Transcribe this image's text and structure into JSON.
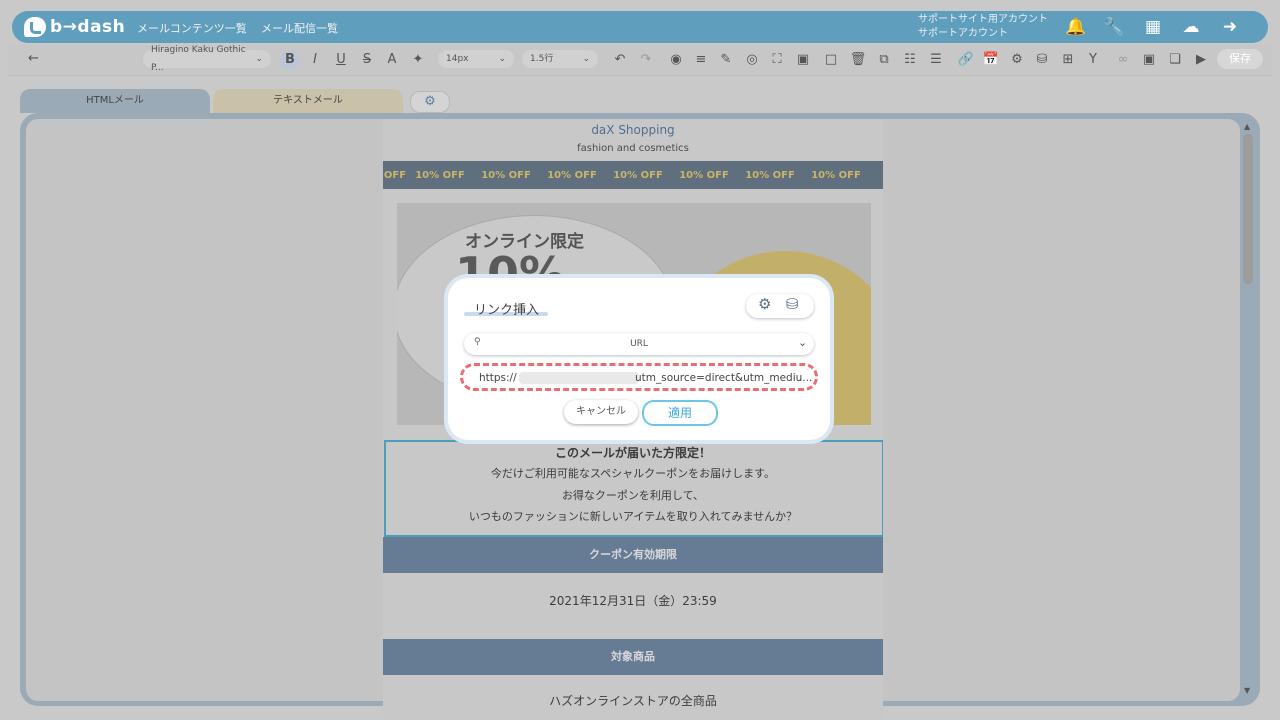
{
  "app": {
    "brand": "b→dash"
  },
  "header": {
    "nav": [
      "メールコンテンツ一覧",
      "メール配信一覧"
    ],
    "account_line1": "サポートサイト用アカウント",
    "account_line2": "サポートアカウント",
    "icons": [
      "bell-icon",
      "wrench-icon",
      "grid-icon",
      "chat-icon",
      "logout-icon"
    ]
  },
  "toolbar": {
    "back": "←",
    "font": "Hiragino Kaku Gothic P...",
    "size": "14px",
    "line_height": "1.5行",
    "save": "保存"
  },
  "tabs": {
    "html": "HTMLメール",
    "text": "テキストメール"
  },
  "email": {
    "shop_name": "daX Shopping",
    "shop_sub": "fashion and cosmetics",
    "band": [
      "OFF",
      "10% OFF",
      "10% OFF",
      "10% OFF",
      "10% OFF",
      "10% OFF",
      "10% OFF",
      "10% OFF"
    ],
    "banner_title": "オンライン限定",
    "banner_big": "10%",
    "body": [
      "このメールが届いた方限定！",
      "今だけご利用可能なスペシャルクーポンをお届けします。",
      "お得なクーポンを利用して、",
      "いつものファッションに新しいアイテムを取り入れてみませんか？"
    ],
    "coupon_head": "クーポン有効期限",
    "coupon_date": "2021年12月31日（金）23:59",
    "target_head": "対象商品",
    "target_text": "ハズオンラインストアの全商品"
  },
  "modal": {
    "title": "リンク挿入",
    "url_type": "URL",
    "url_prefix": "https://",
    "url_suffix": "utm_source=direct&utm_mediu...",
    "cancel": "キャンセル",
    "apply": "適用"
  },
  "colors": {
    "accent": "#5f9fbd",
    "dashed": "#ea6d70",
    "apply": "#39a6d6"
  }
}
